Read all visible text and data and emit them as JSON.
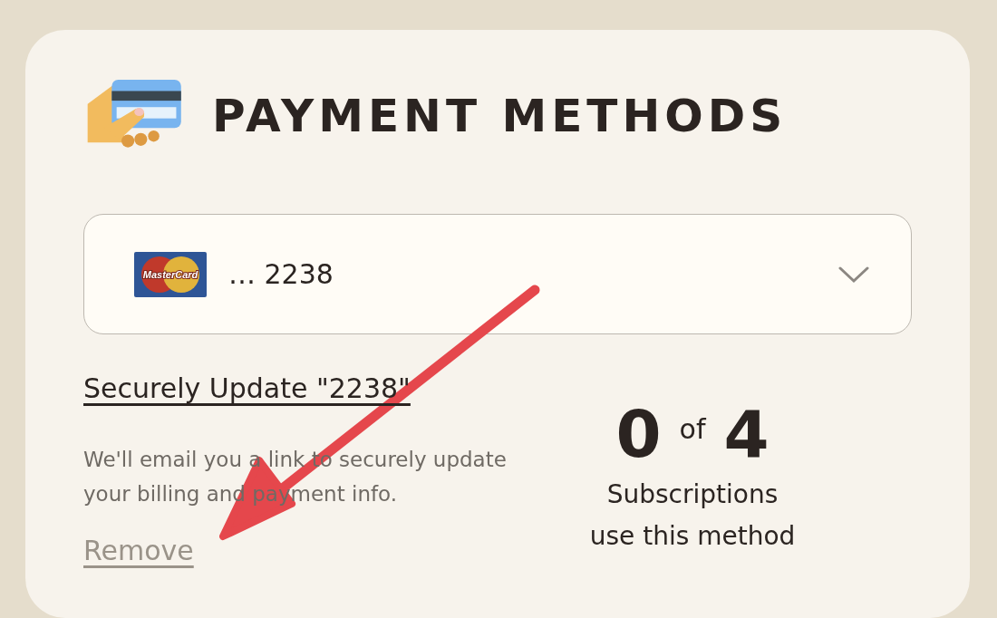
{
  "title": "PAYMENT METHODS",
  "selected_method": {
    "brand_label": "MasterCard",
    "value": "… 2238"
  },
  "update_link": "Securely Update \"2238\"",
  "description": "We'll email you a link to securely update your billing and payment info.",
  "remove_link": "Remove",
  "usage": {
    "count": "0",
    "of": "of",
    "total": "4",
    "caption_line_1": "Subscriptions",
    "caption_line_2": "use this method"
  },
  "annotation": {
    "kind": "arrow"
  }
}
